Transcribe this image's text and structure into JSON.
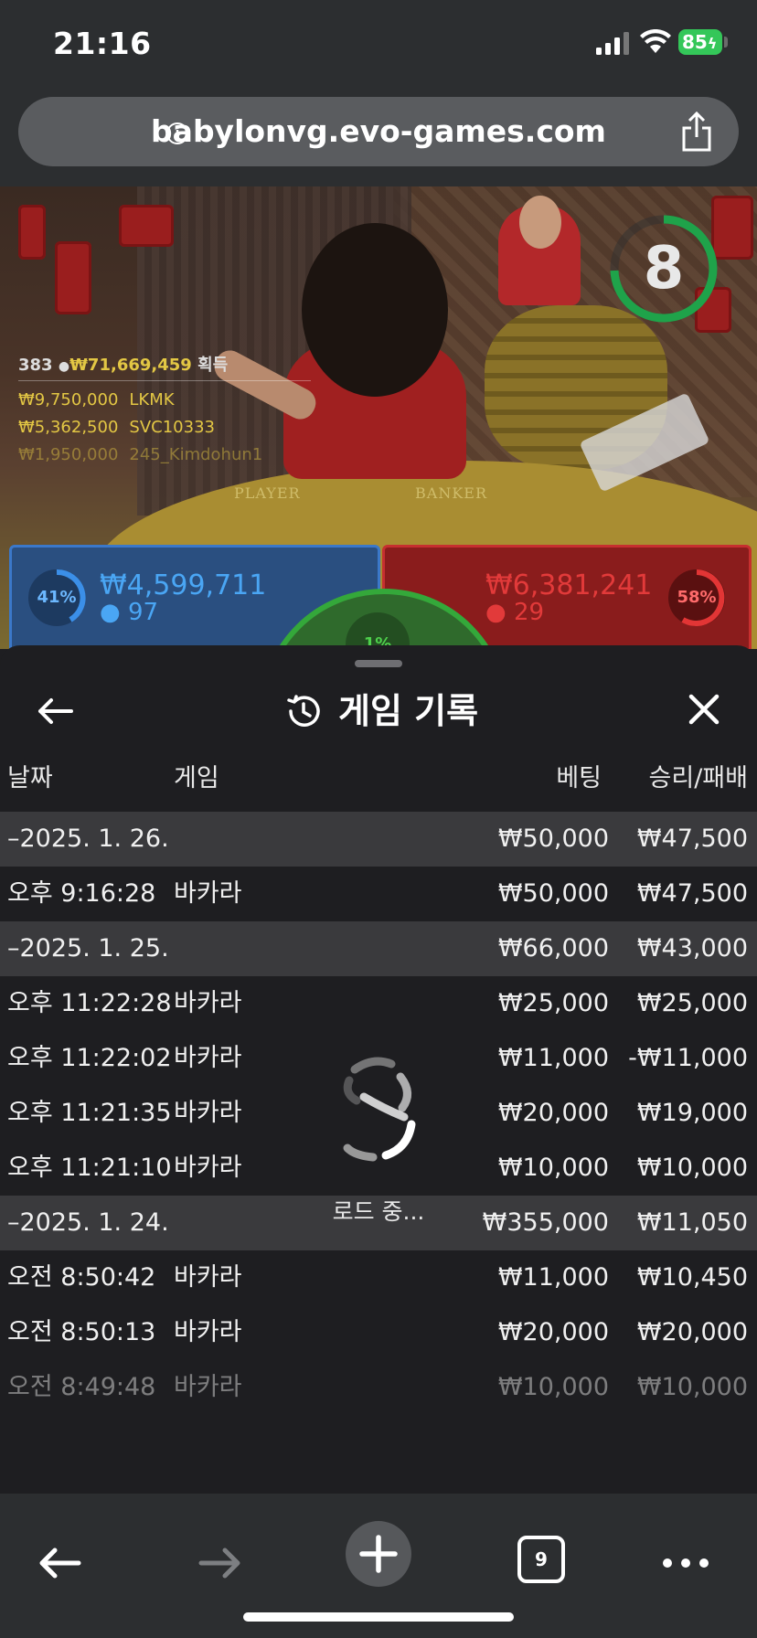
{
  "status_bar": {
    "time": "21:16",
    "battery": "85"
  },
  "browser": {
    "url": "babylonvg.evo-games.com",
    "tab_count": "9"
  },
  "game": {
    "countdown": "8",
    "table_labels": {
      "player": "PLAYER",
      "banker": "BANKER"
    },
    "winners": {
      "count": "383",
      "total": "₩71,669,459",
      "total_suffix": "획득",
      "entries": [
        {
          "amount": "₩9,750,000",
          "name": "LKMK"
        },
        {
          "amount": "₩5,362,500",
          "name": "SVC10333"
        },
        {
          "amount": "₩1,950,000",
          "name": "245_Kimdohun1"
        }
      ]
    },
    "player_bet": {
      "percent": "41%",
      "amount": "₩4,599,711",
      "players": "97"
    },
    "banker_bet": {
      "percent": "58%",
      "amount": "₩6,381,241",
      "players": "29"
    },
    "tie_bet": {
      "percent": "1%"
    }
  },
  "history": {
    "title": "게임 기록",
    "columns": {
      "date": "날짜",
      "game": "게임",
      "bet": "베팅",
      "result": "승리/패배"
    },
    "rows": [
      {
        "type": "date",
        "c1": "–2025. 1. 26.",
        "c2": "",
        "c3": "₩50,000",
        "c4": "₩47,500"
      },
      {
        "type": "game",
        "c1": "오후 9:16:28",
        "c2": "바카라",
        "c3": "₩50,000",
        "c4": "₩47,500"
      },
      {
        "type": "date",
        "c1": "–2025. 1. 25.",
        "c2": "",
        "c3": "₩66,000",
        "c4": "₩43,000"
      },
      {
        "type": "game",
        "c1": "오후 11:22:28",
        "c2": "바카라",
        "c3": "₩25,000",
        "c4": "₩25,000"
      },
      {
        "type": "game",
        "c1": "오후 11:22:02",
        "c2": "바카라",
        "c3": "₩11,000",
        "c4": "-₩11,000"
      },
      {
        "type": "game",
        "c1": "오후 11:21:35",
        "c2": "바카라",
        "c3": "₩20,000",
        "c4": "₩19,000"
      },
      {
        "type": "game",
        "c1": "오후 11:21:10",
        "c2": "바카라",
        "c3": "₩10,000",
        "c4": "₩10,000"
      },
      {
        "type": "date",
        "c1": "–2025. 1. 24.",
        "c2": "",
        "c3": "₩355,000",
        "c4": "₩11,050"
      },
      {
        "type": "game",
        "c1": "오전 8:50:42",
        "c2": "바카라",
        "c3": "₩11,000",
        "c4": "₩10,450"
      },
      {
        "type": "game",
        "c1": "오전 8:50:13",
        "c2": "바카라",
        "c3": "₩20,000",
        "c4": "₩20,000"
      },
      {
        "type": "game",
        "c1": "오전 8:49:48",
        "c2": "바카라",
        "c3": "₩10,000",
        "c4": "₩10,000"
      }
    ],
    "loading_text": "로드 중..."
  }
}
